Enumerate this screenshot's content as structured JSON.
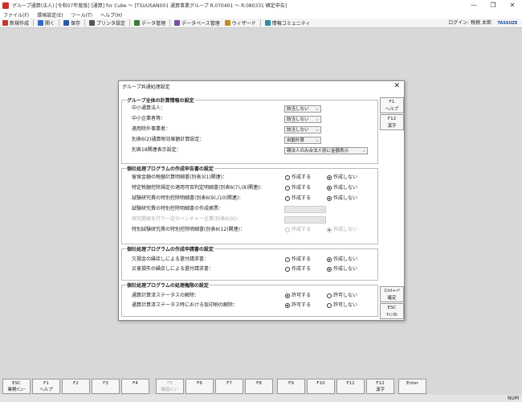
{
  "window": {
    "title": "グループ通算(法人) [令和07年度版] [通算] for Cube ～ [TSUUSAN001 通算事業グループ R.070401 ～ R.080331 確定申告]",
    "controls": [
      "—",
      "❐",
      "✕"
    ]
  },
  "menu": [
    "ファイル(F)",
    "環境設定(E)",
    "ツール(T)",
    "ヘルプ(H)"
  ],
  "toolbar": {
    "buttons": [
      {
        "label": "新規作成",
        "color": "#c23a2e"
      },
      {
        "label": "開く",
        "color": "#2d6bc2"
      },
      {
        "label": "保存",
        "color": "#2b5aa8"
      },
      {
        "label": "プリンタ設定",
        "color": "#555555"
      },
      {
        "label": "データ管理",
        "color": "#3a7d3a"
      },
      {
        "label": "データベース管理",
        "color": "#7a4fa3"
      },
      {
        "label": "ウィザード",
        "color": "#c48a1e"
      },
      {
        "label": "情報コミュニティ",
        "color": "#2c8aa8"
      }
    ],
    "login": "ログイン: 税務 太郎",
    "logo": "TASSUZE"
  },
  "dialog": {
    "title": "グループ共通処理設定",
    "close": "✕",
    "side_buttons": [
      {
        "key": "F1",
        "label": "ヘルプ"
      },
      {
        "key": "F12",
        "label": "漢字"
      },
      {
        "key": "Ctrl+⏎",
        "label": "確定"
      },
      {
        "key": "ESC",
        "label": "ｷｬﾝｾﾙ"
      }
    ],
    "group1": {
      "title": "グループ全体の計算情報の設定",
      "rows": [
        {
          "label": "中小通算法人：",
          "value": "該当しない"
        },
        {
          "label": "中小企業者等：",
          "value": "該当しない"
        },
        {
          "label": "適用除外事業者：",
          "value": "該当しない"
        },
        {
          "label": "別表6(2)通算税効果額計算設定：",
          "value": "自動計算"
        },
        {
          "label": "別表18関連表示設定：",
          "value": "親法人のみ合法人別に金額表示"
        }
      ]
    },
    "group2": {
      "title": "個社処理プログラムの作成申告書の設定",
      "rows": [
        {
          "label": "留保金額の税額計算明細書(別表3(1)関連)：",
          "opt1": "作成する",
          "opt2": "作成しない",
          "selected": 2
        },
        {
          "label": "特定税額控除規定の適用可否判定明細書(別表6(7),(8)関連)：",
          "opt1": "作成する",
          "opt2": "作成しない",
          "selected": 2
        },
        {
          "label": "試験研究費の特別控除明細書(別表6(9),(10)関連)：",
          "opt1": "作成する",
          "opt2": "作成しない",
          "selected": 2
        },
        {
          "label": "試験研究費の特別控除明細書の作成帳票：",
          "value": ""
        },
        {
          "label": "研究開発を行う一定のベンチャー企業(別表6(9))：",
          "value": ""
        },
        {
          "label": "特別試験研究費の特別控除明細書(別表6(12)関連)：",
          "opt1": "作成する",
          "opt2": "作成しない",
          "selected": 2
        }
      ]
    },
    "group3": {
      "title": "個社処理プログラムの作成申請書の設定",
      "rows": [
        {
          "label": "欠損金の繰戻しによる還付請求書：",
          "opt1": "作成する",
          "opt2": "作成しない",
          "selected": 2
        },
        {
          "label": "災害損失の繰戻しによる還付請求書：",
          "opt1": "作成する",
          "opt2": "作成しない",
          "selected": 2
        }
      ]
    },
    "group4": {
      "title": "個社処理プログラムの処理権限の設定",
      "rows": [
        {
          "label": "通算計算済ステータスの解除：",
          "opt1": "許可する",
          "opt2": "許可しない",
          "selected": 1
        },
        {
          "label": "通算計算済ステータス時における仮印刷の解除：",
          "opt1": "許可する",
          "opt2": "許可しない",
          "selected": 1
        }
      ]
    }
  },
  "fkeys": [
    {
      "key": "ESC",
      "label": "業務ﾒﾆｭｰ",
      "enabled": true
    },
    {
      "key": "F1",
      "label": "ヘルプ",
      "enabled": true
    },
    {
      "key": "F2",
      "label": "",
      "enabled": true
    },
    {
      "key": "F3",
      "label": "",
      "enabled": true
    },
    {
      "key": "F4",
      "label": "",
      "enabled": true
    },
    {
      "key": "F5",
      "label": "機能ﾒﾆｭｰ",
      "enabled": false
    },
    {
      "key": "F6",
      "label": "",
      "enabled": true
    },
    {
      "key": "F7",
      "label": "",
      "enabled": true
    },
    {
      "key": "F8",
      "label": "",
      "enabled": true
    },
    {
      "key": "F9",
      "label": "",
      "enabled": true
    },
    {
      "key": "F10",
      "label": "",
      "enabled": true
    },
    {
      "key": "F11",
      "label": "",
      "enabled": true
    },
    {
      "key": "F12",
      "label": "漢字",
      "enabled": true
    },
    {
      "key": "Enter",
      "label": "",
      "enabled": true
    }
  ],
  "status": {
    "num": "NUM"
  }
}
